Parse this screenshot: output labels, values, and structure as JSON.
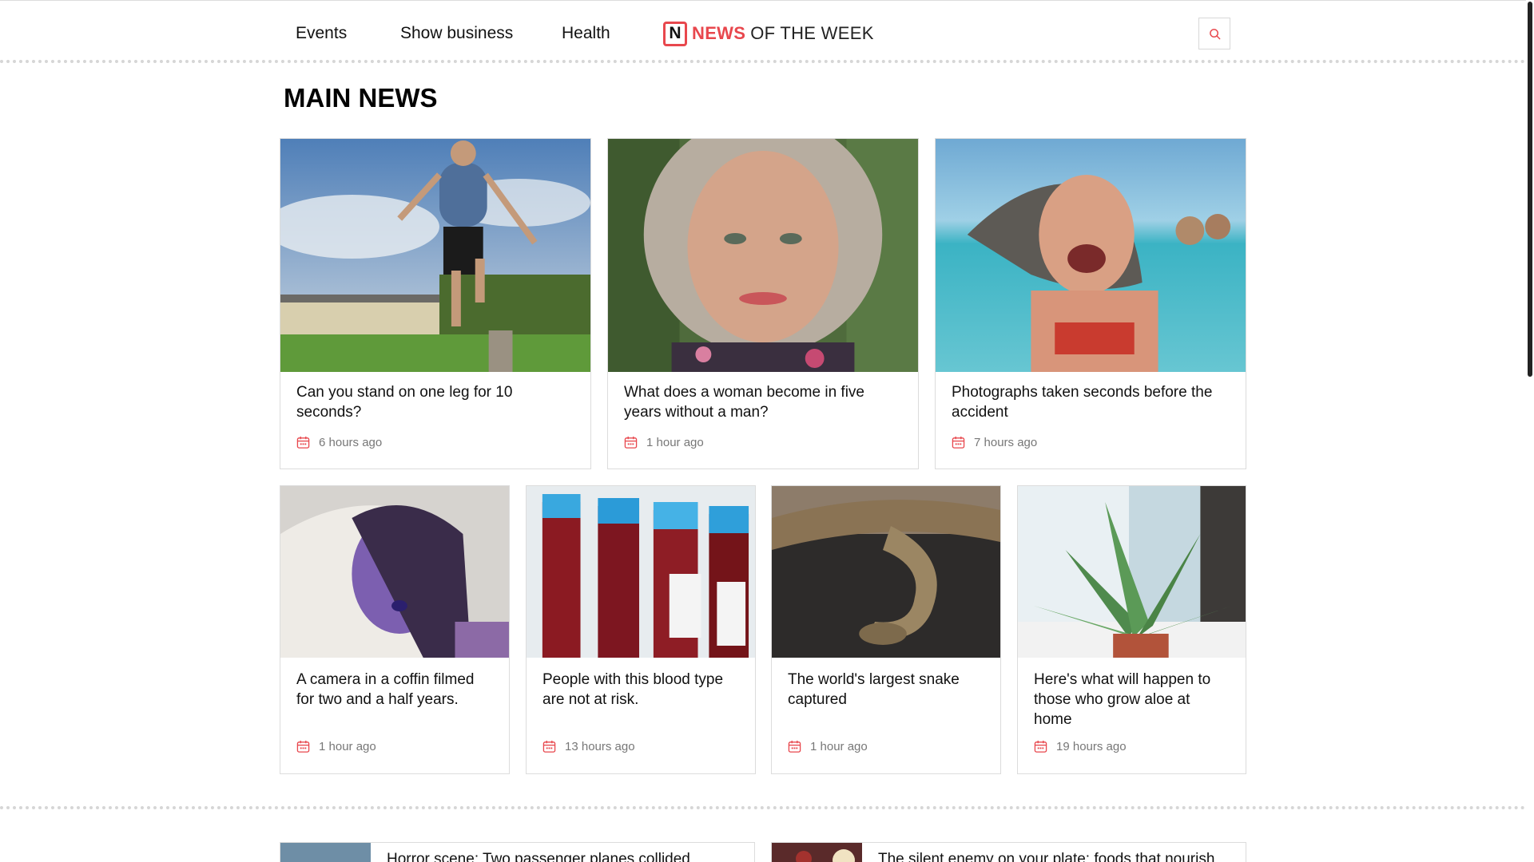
{
  "nav": {
    "links": [
      "Events",
      "Show business",
      "Health"
    ],
    "logo": {
      "letter": "N",
      "red": "NEWS",
      "rest": "OF THE WEEK"
    },
    "accent_color": "#e8474d",
    "search_icon": "search-icon"
  },
  "main": {
    "section_title": "MAIN NEWS",
    "top_cards": [
      {
        "title": "Can you stand on one leg for 10 seconds?",
        "time": "6 hours ago",
        "image": "man-balancing-on-one-leg"
      },
      {
        "title": "What does a woman become in five years without a man?",
        "time": "1 hour ago",
        "image": "woman-portrait"
      },
      {
        "title": "Photographs taken seconds before the accident",
        "time": "7 hours ago",
        "image": "woman-in-sea-with-seal"
      }
    ],
    "small_cards": [
      {
        "title": "A camera in a coffin filmed for two and a half years.",
        "time": "1 hour ago",
        "image": "woman-in-coffin"
      },
      {
        "title": "People with this blood type are not at risk.",
        "time": "13 hours ago",
        "image": "blood-sample-tubes"
      },
      {
        "title": "The world's largest snake captured",
        "time": "1 hour ago",
        "image": "python-snake"
      },
      {
        "title": "Here's what will happen to those who grow aloe at home",
        "time": "19 hours ago",
        "image": "aloe-plant"
      }
    ],
    "time_icon": "calendar-icon"
  },
  "more": {
    "items": [
      {
        "title": "Horror scene: Two passenger planes collided",
        "image": "planes-thumbnail"
      },
      {
        "title": "The silent enemy on your plate: foods that nourish",
        "image": "food-thumbnail"
      }
    ]
  }
}
